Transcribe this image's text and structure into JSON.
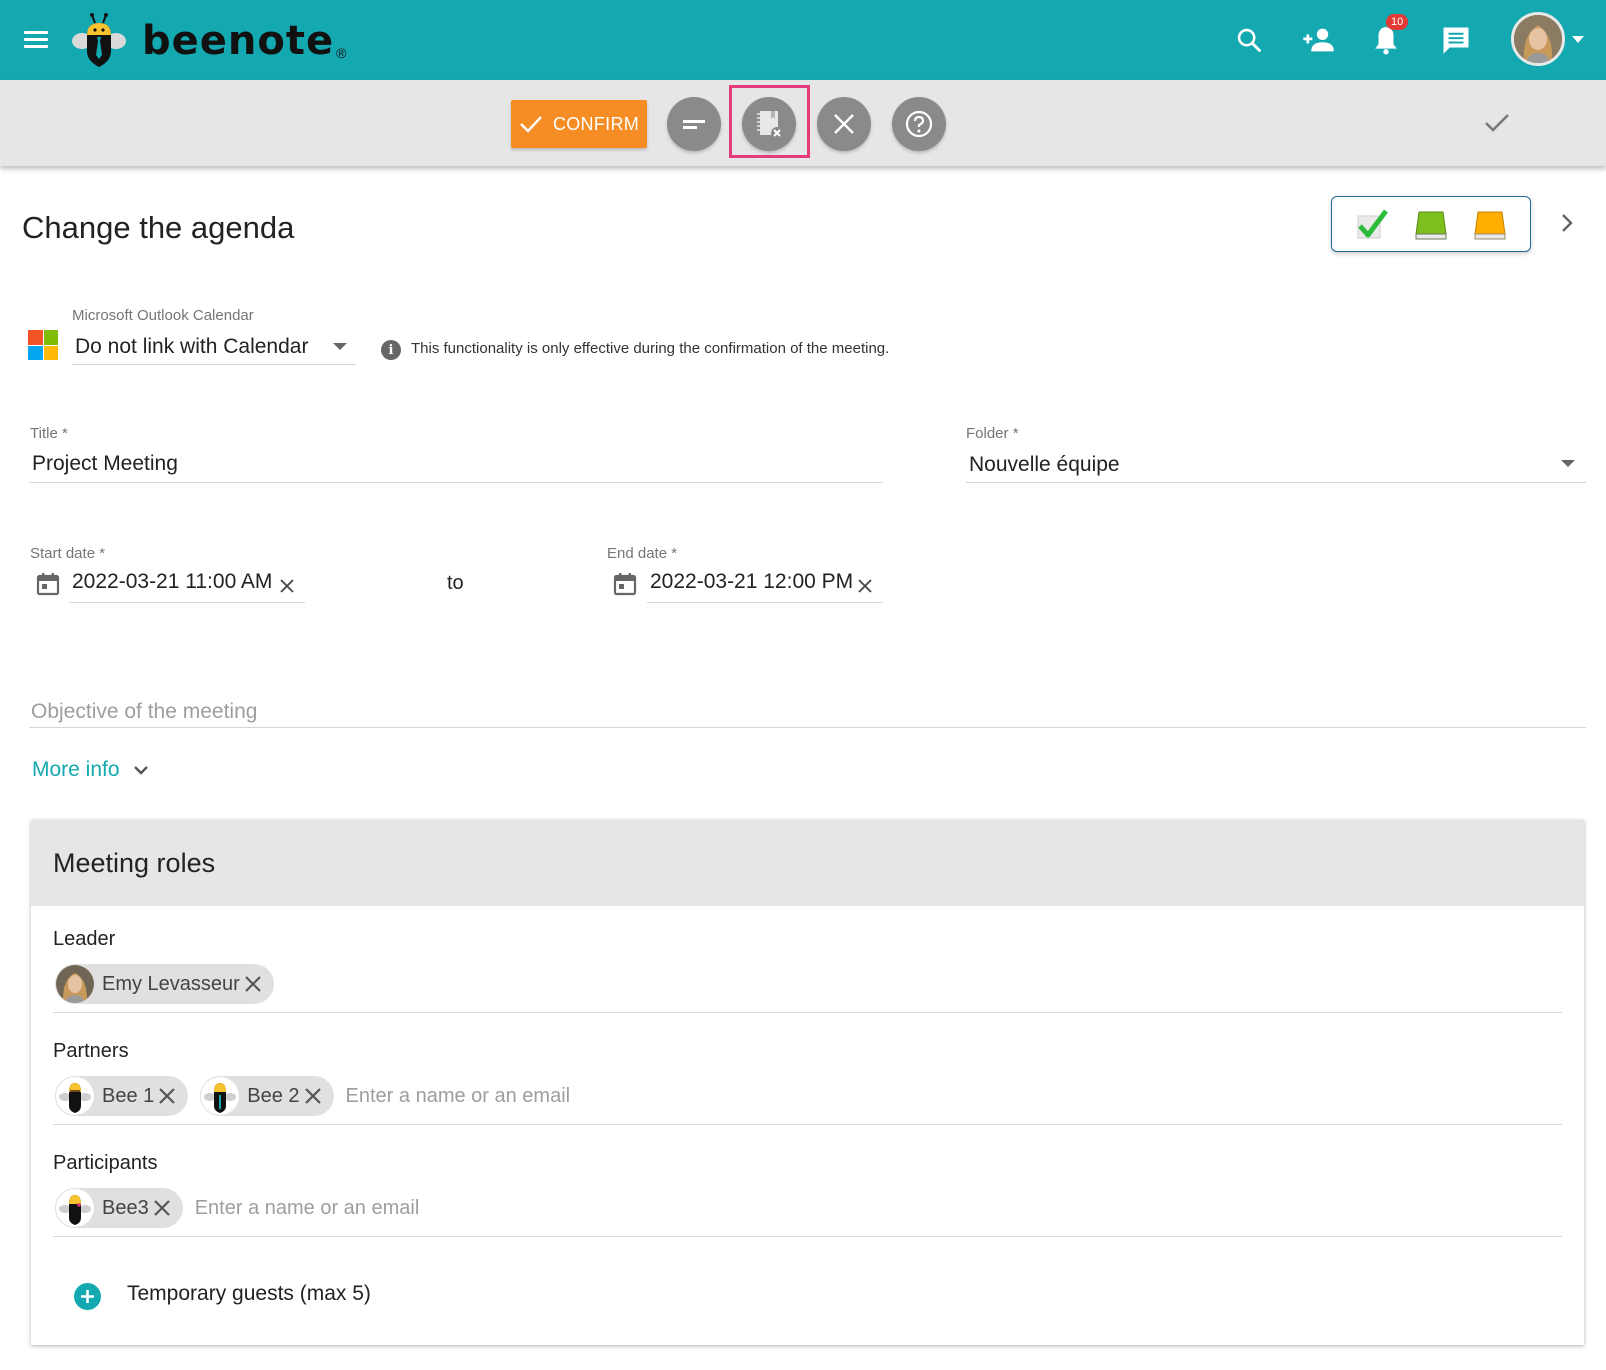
{
  "app": {
    "brand_name": "beenote",
    "brand_mark": "®",
    "colors": {
      "primary": "#14a9b0",
      "confirm": "#f58d24",
      "highlight": "#e63b7a",
      "notification_badge": "#e53935"
    }
  },
  "topbar": {
    "icons": [
      "menu-icon",
      "search-icon",
      "add-user-icon",
      "notifications-icon",
      "chat-icon",
      "user-avatar"
    ],
    "notification_count": "10"
  },
  "toolbar": {
    "confirm_label": "CONFIRM",
    "buttons": [
      {
        "name": "minimize-button",
        "icon": "minus-icon"
      },
      {
        "name": "cancel-agenda-button",
        "icon": "notebook-remove-icon",
        "highlighted": true
      },
      {
        "name": "close-button",
        "icon": "close-icon"
      },
      {
        "name": "help-button",
        "icon": "help-icon"
      }
    ],
    "right_icon": "check-icon"
  },
  "page": {
    "title": "Change the agenda",
    "status_icons": [
      "checked-status-icon",
      "green-book-icon",
      "orange-book-icon"
    ]
  },
  "calendar_link": {
    "label": "Microsoft Outlook Calendar",
    "selected": "Do not link with Calendar",
    "info": "This functionality is only effective during the confirmation of the meeting."
  },
  "form": {
    "title_label": "Title",
    "title_value": "Project Meeting",
    "folder_label": "Folder",
    "folder_value": "Nouvelle équipe",
    "required_mark": "*",
    "start_label": "Start date",
    "start_value": "2022-03-21 11:00 AM",
    "to_label": "to",
    "end_label": "End date",
    "end_value": "2022-03-21 12:00 PM",
    "objective_placeholder": "Objective of the meeting",
    "more_info_label": "More info"
  },
  "roles": {
    "title": "Meeting roles",
    "leader_label": "Leader",
    "leader": [
      {
        "name": "Emy Levasseur",
        "avatar": "photo"
      }
    ],
    "partners_label": "Partners",
    "partners": [
      {
        "name": "Bee 1",
        "avatar": "bee"
      },
      {
        "name": "Bee 2",
        "avatar": "bee"
      }
    ],
    "participants_label": "Participants",
    "participants": [
      {
        "name": "Bee3",
        "avatar": "bee"
      }
    ],
    "input_placeholder": "Enter a name or an email",
    "temporary_guests_label": "Temporary guests (max 5)"
  }
}
